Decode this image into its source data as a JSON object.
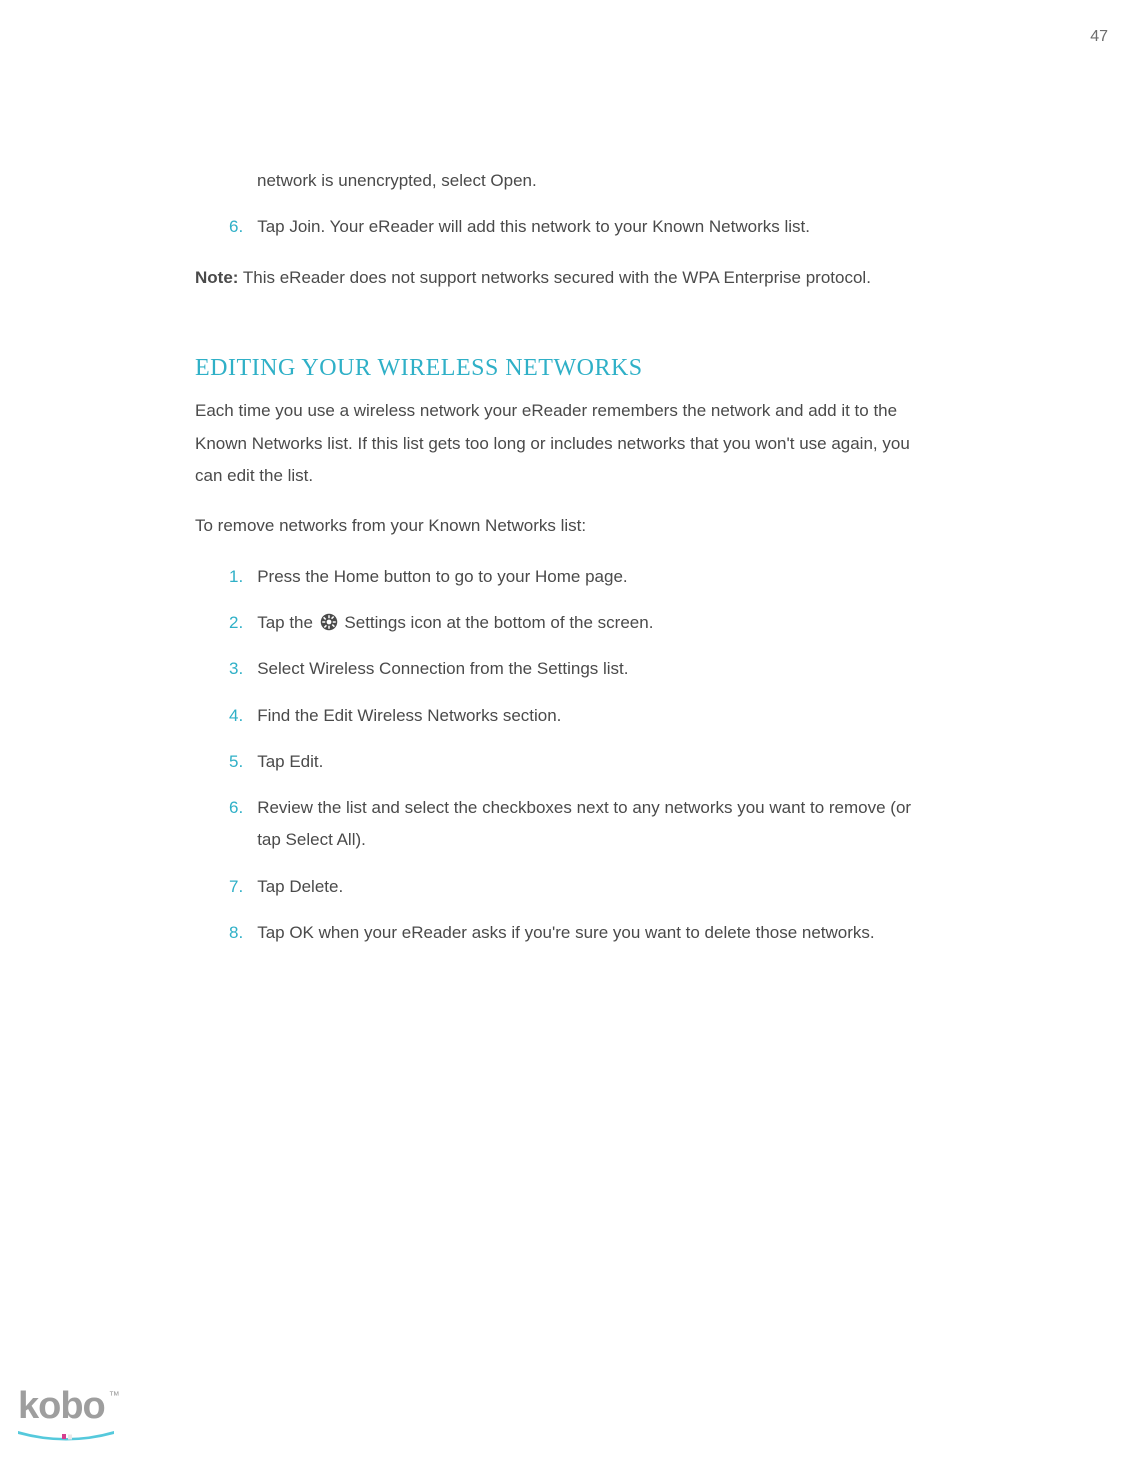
{
  "page_number": "47",
  "top_list": {
    "fragment": "network is unencrypted, select Open.",
    "items": [
      {
        "num": "6.",
        "text": "Tap Join. Your eReader will add this network to your Known Networks list."
      }
    ]
  },
  "note": {
    "label": "Note:",
    "text": " This eReader does not support networks secured with the WPA Enterprise protocol."
  },
  "section": {
    "heading": "EDITING YOUR WIRELESS NETWORKS",
    "intro": "Each time you use a wireless network your eReader remembers the network and add it to the Known Networks list. If this list gets too long or includes networks that you won't use again, you can edit the list.",
    "lead": "To remove networks from your Known Networks list:",
    "steps": [
      {
        "num": "1.",
        "text": "Press the Home button to go to your Home page."
      },
      {
        "num": "2.",
        "pre": "Tap the ",
        "post": " Settings icon at the bottom of the screen.",
        "icon": "gear"
      },
      {
        "num": "3.",
        "text": "Select Wireless Connection from the Settings list."
      },
      {
        "num": "4.",
        "text": "Find the Edit Wireless Networks section."
      },
      {
        "num": "5.",
        "text": "Tap Edit."
      },
      {
        "num": "6.",
        "text": "Review the list and select the checkboxes next to any networks you want to remove (or tap Select All)."
      },
      {
        "num": "7.",
        "text": "Tap Delete."
      },
      {
        "num": "8.",
        "text": "Tap OK when your eReader asks if you're sure you want to delete those networks."
      }
    ]
  },
  "footer": {
    "brand": "kobo",
    "tm": "™"
  }
}
